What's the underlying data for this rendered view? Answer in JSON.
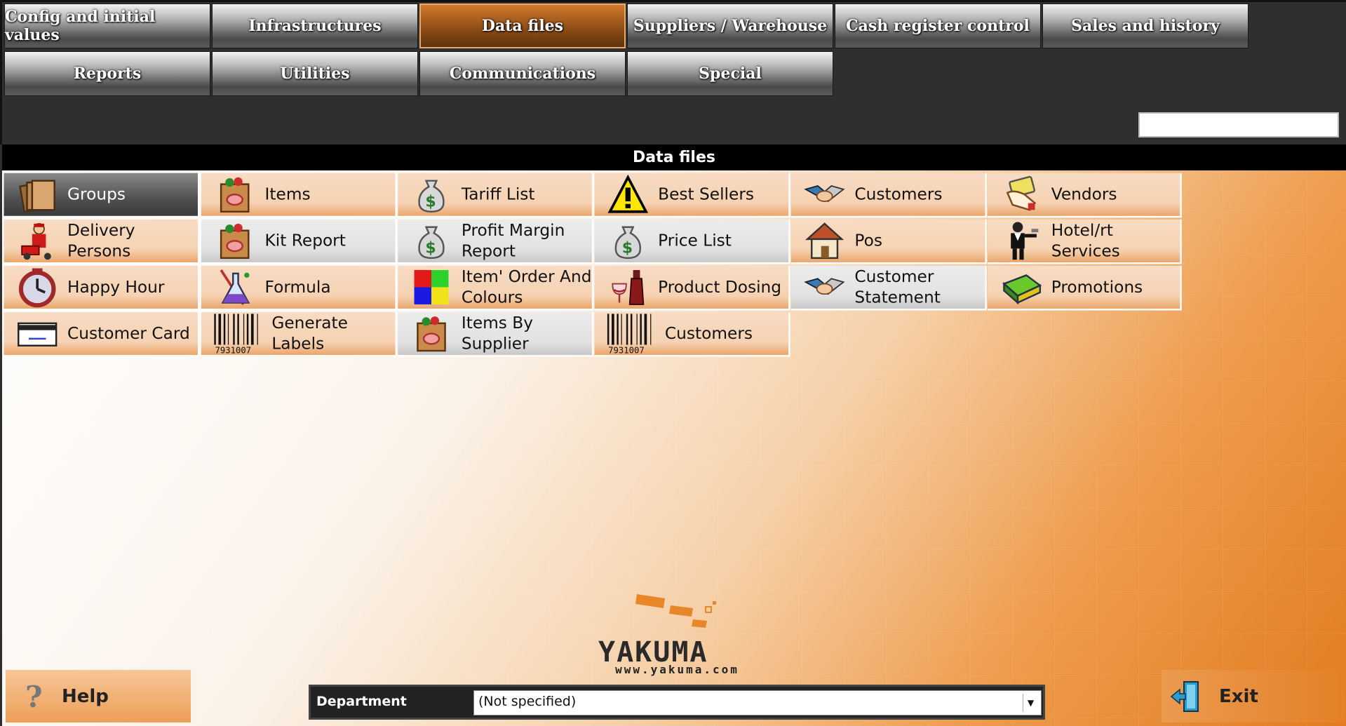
{
  "nav": {
    "row1": [
      {
        "label": "Config and initial values"
      },
      {
        "label": "Infrastructures"
      },
      {
        "label": "Data files",
        "active": true
      },
      {
        "label": "Suppliers / Warehouse"
      },
      {
        "label": "Cash register control"
      },
      {
        "label": "Sales and history"
      }
    ],
    "row2": [
      {
        "label": "Reports"
      },
      {
        "label": "Utilities"
      },
      {
        "label": "Communications"
      },
      {
        "label": "Special"
      }
    ],
    "search_value": ""
  },
  "section_title": "Data files",
  "tiles": [
    {
      "label": "Groups",
      "icon": "folders-icon",
      "style": "selected"
    },
    {
      "label": "Items",
      "icon": "shopping-bag-icon",
      "style": "orange"
    },
    {
      "label": "Tariff List",
      "icon": "money-bag-icon",
      "style": "orange"
    },
    {
      "label": "Best Sellers",
      "icon": "warning-icon",
      "style": "orange"
    },
    {
      "label": "Customers",
      "icon": "handshake-icon",
      "style": "orange"
    },
    {
      "label": "Vendors",
      "icon": "hand-card-icon",
      "style": "orange"
    },
    {
      "label": "Delivery Persons",
      "icon": "delivery-person-icon",
      "style": "orange"
    },
    {
      "label": "Kit Report",
      "icon": "shopping-bag-icon",
      "style": "light"
    },
    {
      "label": "Profit Margin Report",
      "icon": "money-bag-icon",
      "style": "light"
    },
    {
      "label": "Price List",
      "icon": "money-bag-icon",
      "style": "light"
    },
    {
      "label": "Pos",
      "icon": "house-icon",
      "style": "orange"
    },
    {
      "label": "Hotel/rt Services",
      "icon": "waiter-icon",
      "style": "orange"
    },
    {
      "label": "Happy Hour",
      "icon": "clock-icon",
      "style": "orange"
    },
    {
      "label": "Formula",
      "icon": "flask-icon",
      "style": "orange"
    },
    {
      "label": "Item' Order And Colours",
      "icon": "color-grid-icon",
      "style": "orange"
    },
    {
      "label": "Product Dosing",
      "icon": "wine-icon",
      "style": "orange"
    },
    {
      "label": "Customer Statement",
      "icon": "handshake-icon",
      "style": "light"
    },
    {
      "label": "Promotions",
      "icon": "cash-stack-icon",
      "style": "orange"
    },
    {
      "label": "Customer Card",
      "icon": "card-icon",
      "style": "orange"
    },
    {
      "label": "Generate Labels",
      "icon": "barcode-icon",
      "style": "orange"
    },
    {
      "label": "Items By Supplier",
      "icon": "shopping-bag-icon",
      "style": "light"
    },
    {
      "label": "Customers",
      "icon": "barcode-icon",
      "style": "orange"
    }
  ],
  "logo": {
    "name": "YAKUMA",
    "url_text": "www.yakuma.com"
  },
  "help_label": "Help",
  "exit_label": "Exit",
  "department": {
    "label": "Department",
    "value": "(Not specified)"
  },
  "barcode_text": "7931007",
  "colors": {
    "accent": "#e27b1f",
    "active_nav": "#8a4a14",
    "tile": "#f6d2b2"
  }
}
